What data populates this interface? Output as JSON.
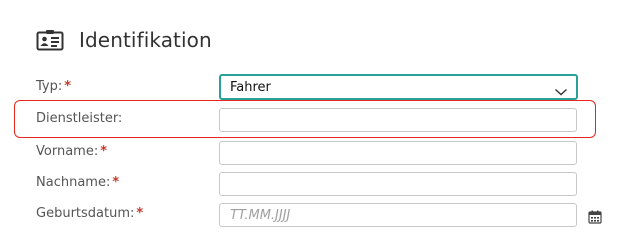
{
  "section": {
    "title": "Identifikation",
    "icon": "id-card-icon"
  },
  "fields": [
    {
      "label": "Typ:",
      "required": true,
      "type": "select",
      "value": "Fahrer",
      "icon": "chevron-down-icon"
    },
    {
      "label": "Dienstleister:",
      "required": false,
      "type": "text",
      "value": "",
      "highlighted": true
    },
    {
      "label": "Vorname:",
      "required": true,
      "type": "text",
      "value": ""
    },
    {
      "label": "Nachname:",
      "required": true,
      "type": "text",
      "value": ""
    },
    {
      "label": "Geburtsdatum:",
      "required": true,
      "type": "date",
      "value": "",
      "placeholder": "TT.MM.JJJJ",
      "icon": "calendar-icon"
    }
  ],
  "required_marker": "*",
  "colors": {
    "accent": "#2aa198",
    "required": "#c0392b",
    "highlight": "#e8261e"
  }
}
